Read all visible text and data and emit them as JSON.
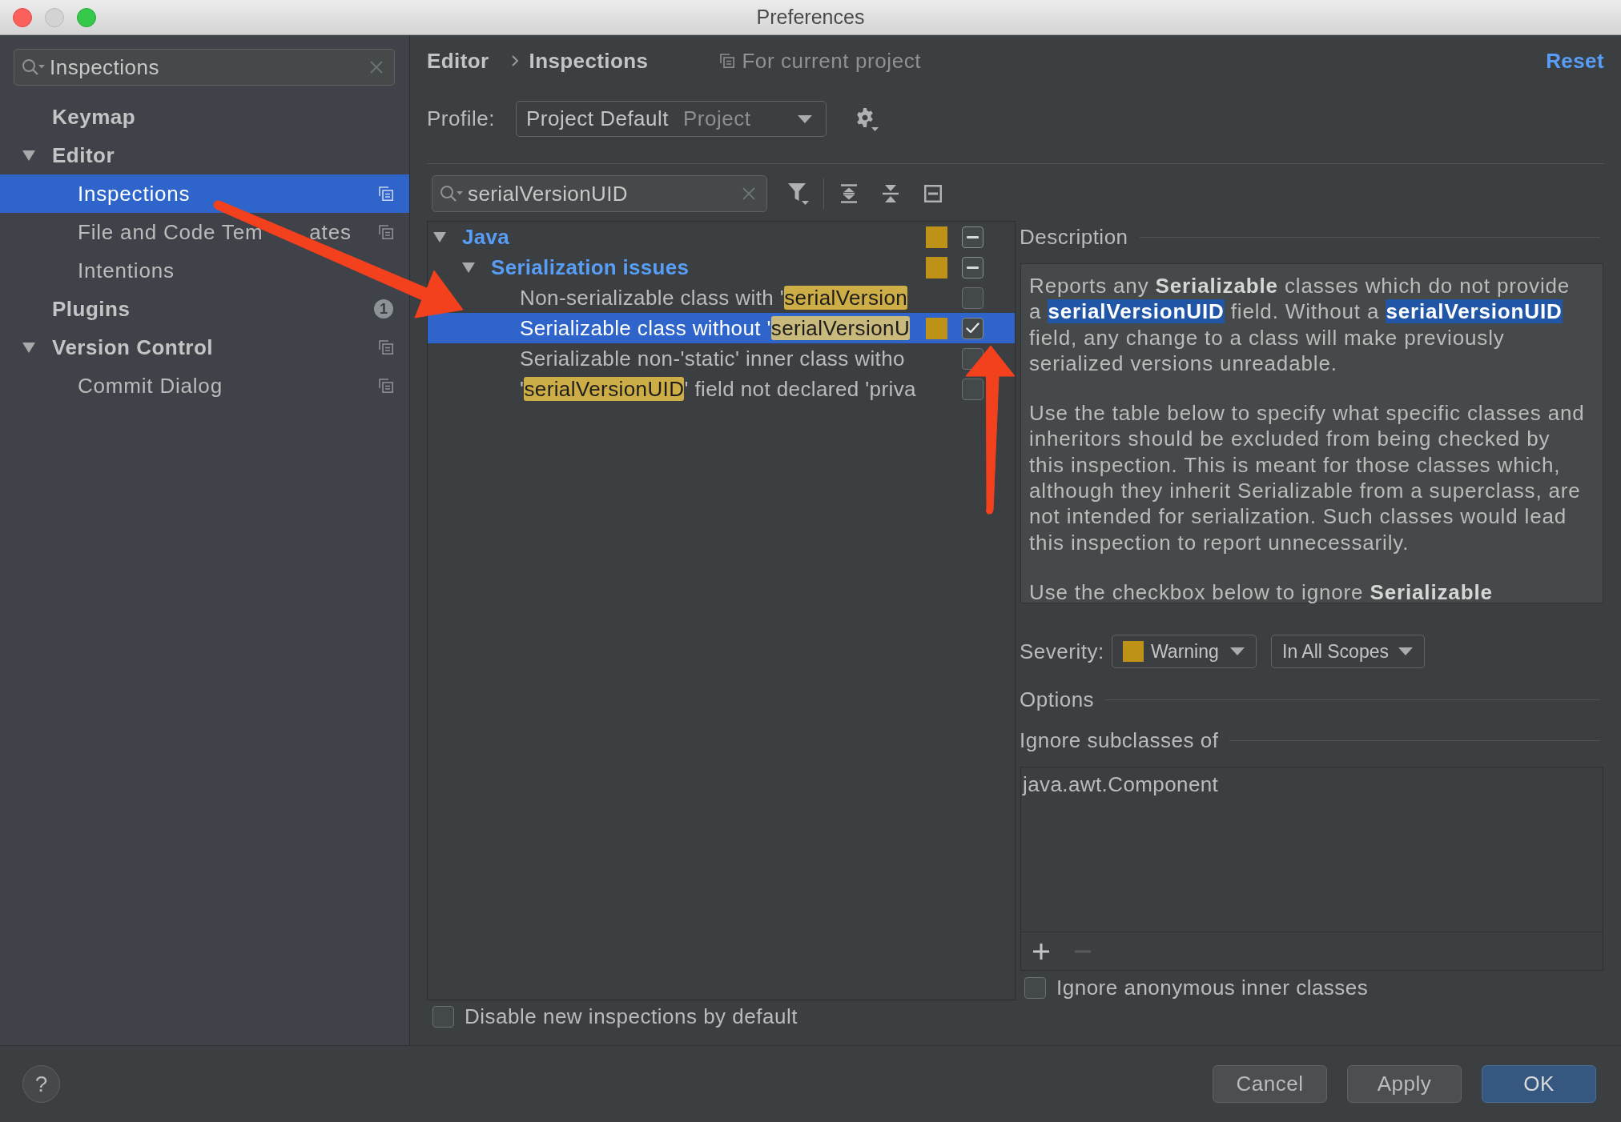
{
  "window": {
    "title": "Preferences"
  },
  "sidebar": {
    "search": {
      "value": "Inspections"
    },
    "items": [
      {
        "label": "Keymap",
        "selected": false,
        "project_scope": false
      },
      {
        "label": "Editor",
        "selected": false,
        "project_scope": false,
        "expanded": true,
        "children": [
          {
            "label": "Inspections",
            "selected": true,
            "project_scope": true
          },
          {
            "label_parts": [
              "File and Code Tem",
              "ates"
            ],
            "selected": false,
            "project_scope": true
          },
          {
            "label": "Intentions",
            "selected": false,
            "project_scope": false
          }
        ]
      },
      {
        "label": "Plugins",
        "selected": false,
        "project_scope": false,
        "badge": "1"
      },
      {
        "label": "Version Control",
        "selected": false,
        "project_scope": true,
        "expanded": true,
        "children": [
          {
            "label": "Commit Dialog",
            "selected": false,
            "project_scope": true
          }
        ]
      }
    ]
  },
  "header": {
    "breadcrumb": [
      "Editor",
      "Inspections"
    ],
    "scope_note": "For current project",
    "reset": "Reset"
  },
  "profile": {
    "label": "Profile:",
    "value": "Project Default",
    "scope": "Project"
  },
  "filter": {
    "value": "serialVersionUID"
  },
  "tree": [
    {
      "kind": "group",
      "segments": [
        {
          "text": "Java",
          "highlight": false
        }
      ],
      "expanded": true,
      "selected": false,
      "color": "#be9117",
      "mixed": true,
      "children": [
        {
          "kind": "group",
          "segments": [
            {
              "text": "Serialization issues",
              "highlight": false
            }
          ],
          "expanded": true,
          "selected": false,
          "color": "#be9117",
          "mixed": true,
          "children": [
            {
              "kind": "inspection",
              "segments": [
                {
                  "text": "Non-serializable class with '",
                  "highlight": false
                },
                {
                  "text": "serialVersion",
                  "highlight": true
                }
              ],
              "selected": false,
              "checked": false
            },
            {
              "kind": "inspection",
              "segments": [
                {
                  "text": "Serializable class without '",
                  "highlight": false
                },
                {
                  "text": "serialVersionU",
                  "highlight": true
                }
              ],
              "selected": true,
              "color": "#be9117",
              "checked": true
            },
            {
              "kind": "inspection",
              "segments": [
                {
                  "text": "Serializable non-'static' inner class witho",
                  "highlight": false
                }
              ],
              "selected": false,
              "checked": false
            },
            {
              "kind": "inspection",
              "segments": [
                {
                  "text": "'",
                  "highlight": false
                },
                {
                  "text": "serialVersionUID",
                  "highlight": true
                },
                {
                  "text": "' field not declared 'priva",
                  "highlight": false
                }
              ],
              "selected": false,
              "checked": false
            }
          ]
        }
      ]
    }
  ],
  "description": {
    "heading": "Description",
    "paragraphs": [
      [
        {
          "text": "Reports any **Serializable** classes which do not provide a ",
          "highlight": false
        },
        {
          "text": "serialVersionUID",
          "highlight": true
        },
        {
          "text": " field. Without a ",
          "highlight": false
        },
        {
          "text": "serialVersionUID",
          "highlight": true
        },
        {
          "text": " field, any change to a class will make previously serialized versions unreadable.",
          "highlight": false
        }
      ],
      [
        {
          "text": "Use the table below to specify what specific classes and inheritors should be excluded from being checked by this inspection. This is meant for those classes which, although they inherit Serializable from a superclass, are not intended for serialization. Such classes would lead this inspection to report unnecessarily.",
          "highlight": false
        }
      ],
      [
        {
          "text": "Use the checkbox below to ignore **Serializable**",
          "highlight": false
        }
      ]
    ]
  },
  "severity": {
    "label": "Severity:",
    "value": "Warning",
    "color": "#be9117",
    "scope": "In All Scopes"
  },
  "options": {
    "heading": "Options",
    "ignore_subclasses": {
      "heading": "Ignore subclasses of",
      "items": [
        {
          "label": "java.awt.Component",
          "selected": false
        }
      ],
      "toolbar": [
        {
          "kind": "add",
          "disabled": false
        },
        {
          "kind": "remove",
          "disabled": true
        }
      ]
    },
    "ignore_anonymous": {
      "label": "Ignore anonymous inner classes",
      "checked": false
    }
  },
  "disable_new": {
    "label": "Disable new inspections by default",
    "checked": false
  },
  "footer": {
    "help": "?",
    "buttons": [
      {
        "label": "Cancel",
        "default": false
      },
      {
        "label": "Apply",
        "default": false
      },
      {
        "label": "OK",
        "default": true
      }
    ]
  }
}
